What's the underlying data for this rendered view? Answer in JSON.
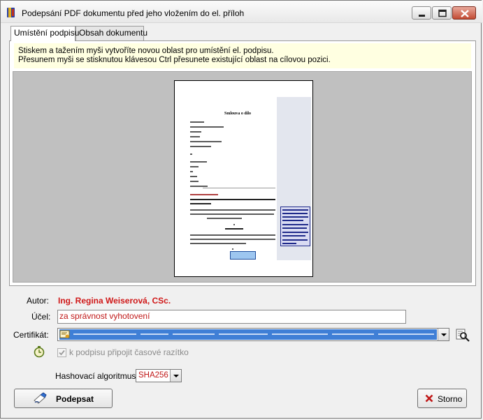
{
  "window": {
    "title": "Podepsání PDF dokumentu před jeho vložením do el. příloh"
  },
  "tabs": [
    {
      "label": "Umístění podpisu",
      "active": true
    },
    {
      "label": "Obsah dokumentu",
      "active": false
    }
  ],
  "info": {
    "line1": "Stiskem a tažením myši vytvoříte novou oblast pro umístění el. podpisu.",
    "line2": "Přesunem myši se stisknutou klávesou Ctrl přesunete existující oblast na cílovou pozici."
  },
  "preview": {
    "document_title": "Smlouva o dílo"
  },
  "form": {
    "author_label": "Autor:",
    "author_value": "Ing. Regina Weiserová, CSc.",
    "purpose_label": "Účel:",
    "purpose_value": "za správnost vyhotovení",
    "certificate_label": "Certifikát:",
    "timestamp_label": "k podpisu připojit časové razítko",
    "timestamp_checked": true,
    "timestamp_enabled": false,
    "hash_label": "Hashovací algoritmus:",
    "hash_value": "SHA256"
  },
  "buttons": {
    "sign_label": "Podepsat",
    "cancel_label": "Storno"
  },
  "colors": {
    "accent_red": "#d01818",
    "selection_blue": "#3f7fd6",
    "info_background": "#ffffe1"
  }
}
